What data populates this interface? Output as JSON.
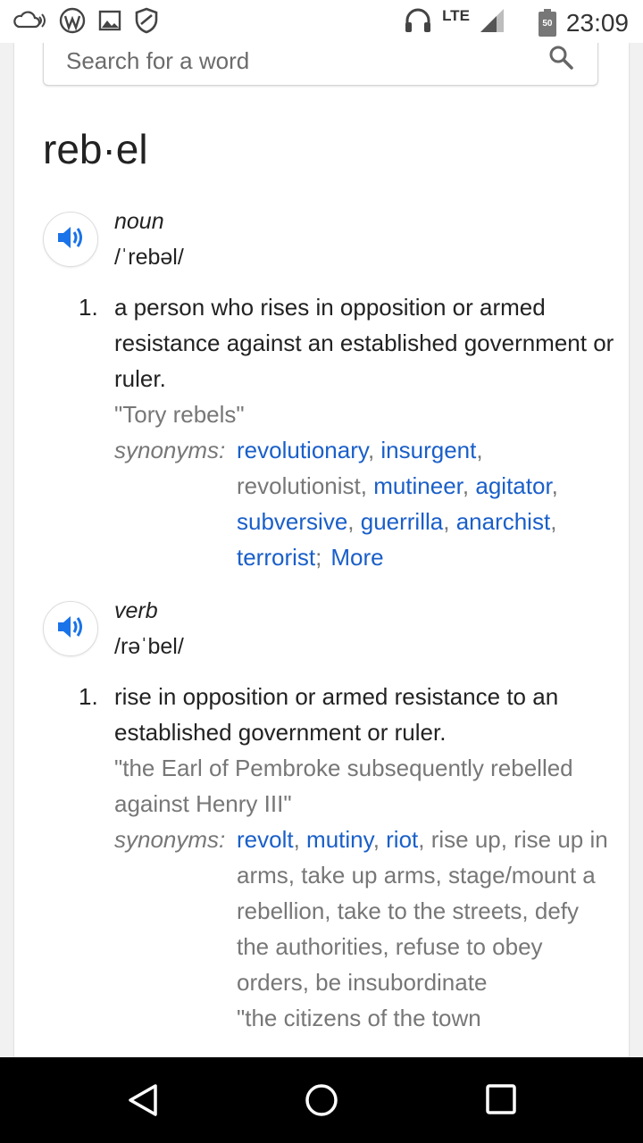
{
  "status_bar": {
    "network": "LTE",
    "battery": "50",
    "time": "23:09",
    "icons": [
      "cloud-icon",
      "wordpress-icon",
      "image-icon",
      "shield-icon",
      "headset-icon",
      "signal-icon",
      "battery-icon"
    ]
  },
  "search": {
    "placeholder": "Search for a word"
  },
  "entry": {
    "headword": "reb·el",
    "blocks": [
      {
        "pos": "noun",
        "pronunciation": "/ˈrebəl/",
        "sense_number": "1.",
        "definition": "a person who rises in opposition or armed resistance against an established government or ruler.",
        "example": "\"Tory rebels\"",
        "synonyms_label": "synonyms:",
        "synonyms": [
          {
            "text": "revolutionary",
            "link": true
          },
          {
            "text": "insurgent",
            "link": true
          },
          {
            "text": "revolutionist",
            "link": false
          },
          {
            "text": "mutineer",
            "link": true
          },
          {
            "text": "agitator",
            "link": true
          },
          {
            "text": "subversive",
            "link": true
          },
          {
            "text": "guerrilla",
            "link": true
          },
          {
            "text": "anarchist",
            "link": true
          },
          {
            "text": "terrorist",
            "link": true
          }
        ],
        "more_label": "More"
      },
      {
        "pos": "verb",
        "pronunciation": "/rəˈbel/",
        "sense_number": "1.",
        "definition": "rise in opposition or armed resistance to an established government or ruler.",
        "example": "\"the Earl of Pembroke subsequently rebelled against Henry III\"",
        "synonyms_label": "synonyms:",
        "synonyms": [
          {
            "text": "revolt",
            "link": true
          },
          {
            "text": "mutiny",
            "link": true
          },
          {
            "text": "riot",
            "link": true
          },
          {
            "text": "rise up",
            "link": false
          },
          {
            "text": "rise up in arms",
            "link": false
          },
          {
            "text": "take up arms",
            "link": false
          },
          {
            "text": "stage/mount a rebellion",
            "link": false
          },
          {
            "text": "take to the streets",
            "link": false
          },
          {
            "text": "defy the authorities",
            "link": false
          },
          {
            "text": "refuse to obey orders",
            "link": false
          },
          {
            "text": "be insubordinate",
            "link": false
          }
        ],
        "next_example": "\"the citizens of the town"
      }
    ]
  },
  "nav": {
    "buttons": [
      "back-icon",
      "home-icon",
      "recents-icon"
    ]
  },
  "colors": {
    "link": "#1a5fc9",
    "speaker_icon": "#1a73e8",
    "muted_text": "#777777"
  }
}
